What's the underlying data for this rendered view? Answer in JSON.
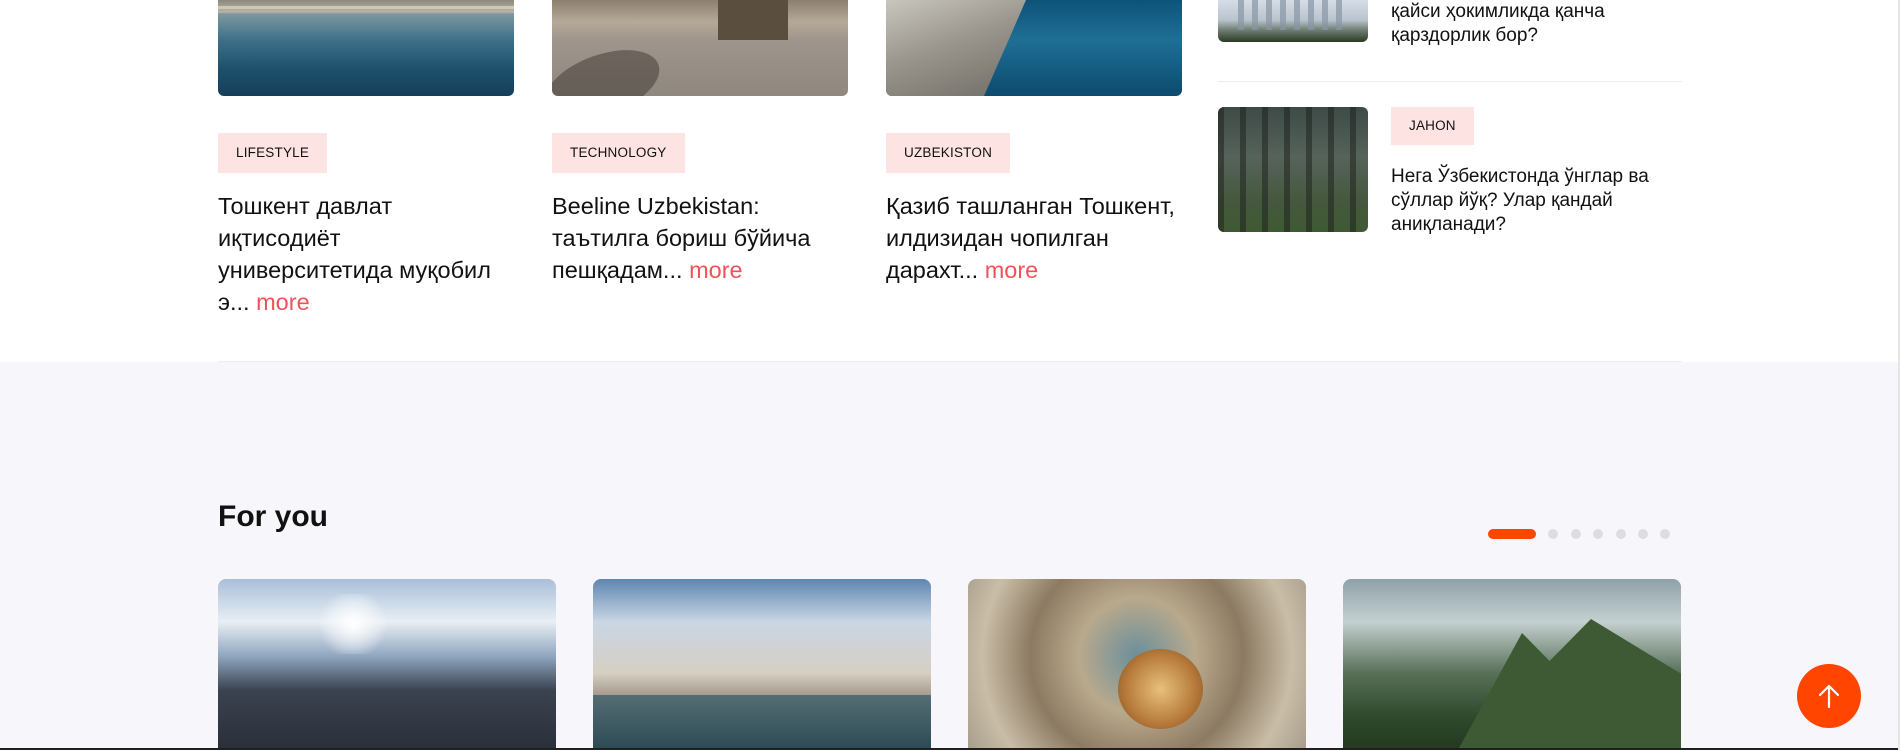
{
  "featured_cards": [
    {
      "tag": "LIFESTYLE",
      "headline": "Тошкент давлат иқтисодиёт университетида муқобил э...",
      "more": "more",
      "image": "canal-water"
    },
    {
      "tag": "TECHNOLOGY",
      "headline": "Beeline Uzbekistan: таътилга бориш бўйича пешқадам...",
      "more": "more",
      "image": "old-street"
    },
    {
      "tag": "UZBEKISTON",
      "headline": "Қазиб ташланган Тошкент, илдизидан чопилган дарахт...",
      "more": "more",
      "image": "river-embankment"
    }
  ],
  "side_list": [
    {
      "title": "қайси ҳокимликда қанча қарздорлик бор?",
      "image": "city-skyline"
    },
    {
      "tag": "JAHON",
      "title": "Нега Ўзбекистонда ўнглар ва сўллар йўқ? Улар қандай аниқланади?",
      "image": "pine-forest"
    }
  ],
  "for_you": {
    "title": "For you",
    "pagination": {
      "total": 7,
      "active": 1
    },
    "cards": [
      {
        "image": "palace-sunlight"
      },
      {
        "image": "palace-riverside"
      },
      {
        "image": "mosaic-dome"
      },
      {
        "image": "green-mountains"
      }
    ]
  },
  "scroll_top": {
    "icon": "arrow-up-icon"
  },
  "colors": {
    "accent": "#ff4500",
    "more_link": "#f15259",
    "tag_bg": "#fde4e3",
    "section_bg": "#f7f7fb"
  }
}
